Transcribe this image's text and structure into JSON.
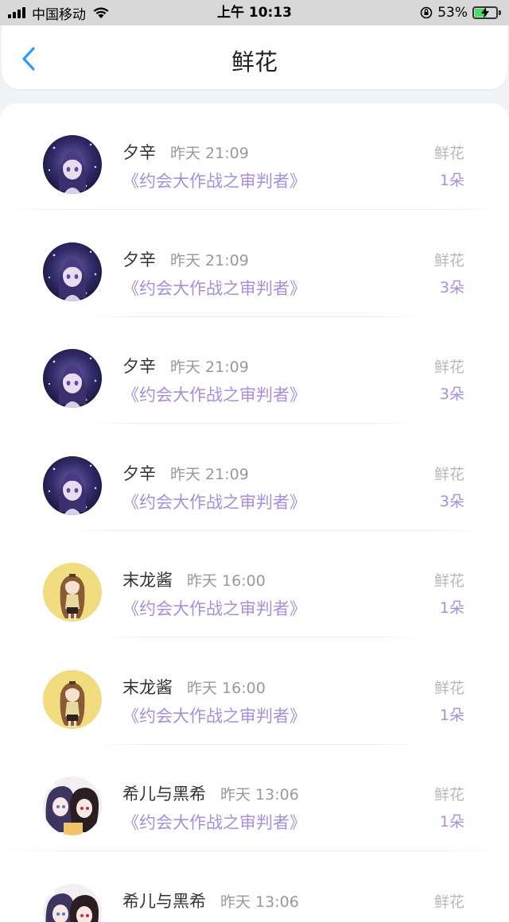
{
  "status_bar": {
    "carrier": "中国移动",
    "time": "上午 10:13",
    "battery_percent": "53%",
    "battery_level": 0.53
  },
  "header": {
    "title": "鲜花",
    "back_icon": "chevron-left-icon"
  },
  "colors": {
    "accent": "#a98fd6",
    "back": "#2a9df4"
  },
  "records": [
    {
      "name": "夕辛",
      "time": "昨天 21:09",
      "work": "《约会大作战之审判者》",
      "gift": "鲜花",
      "count": "1朵",
      "avatar": "purple"
    },
    {
      "name": "夕辛",
      "time": "昨天 21:09",
      "work": "《约会大作战之审判者》",
      "gift": "鲜花",
      "count": "3朵",
      "avatar": "purple"
    },
    {
      "name": "夕辛",
      "time": "昨天 21:09",
      "work": "《约会大作战之审判者》",
      "gift": "鲜花",
      "count": "3朵",
      "avatar": "purple"
    },
    {
      "name": "夕辛",
      "time": "昨天 21:09",
      "work": "《约会大作战之审判者》",
      "gift": "鲜花",
      "count": "3朵",
      "avatar": "purple"
    },
    {
      "name": "末龙酱",
      "time": "昨天 16:00",
      "work": "《约会大作战之审判者》",
      "gift": "鲜花",
      "count": "1朵",
      "avatar": "yellow"
    },
    {
      "name": "末龙酱",
      "time": "昨天 16:00",
      "work": "《约会大作战之审判者》",
      "gift": "鲜花",
      "count": "1朵",
      "avatar": "yellow"
    },
    {
      "name": "希儿与黑希",
      "time": "昨天 13:06",
      "work": "《约会大作战之审判者》",
      "gift": "鲜花",
      "count": "1朵",
      "avatar": "duo"
    },
    {
      "name": "希儿与黑希",
      "time": "昨天 13:06",
      "work": "",
      "gift": "鲜花",
      "count": "",
      "avatar": "duo"
    }
  ]
}
